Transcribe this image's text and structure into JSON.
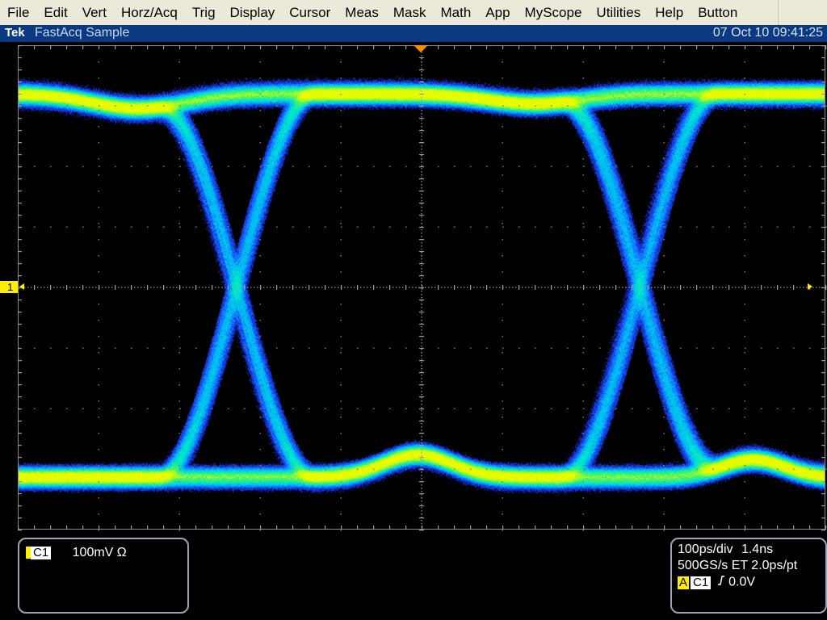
{
  "menu": [
    "File",
    "Edit",
    "Vert",
    "Horz/Acq",
    "Trig",
    "Display",
    "Cursor",
    "Meas",
    "Mask",
    "Math",
    "App",
    "MyScope",
    "Utilities",
    "Help",
    "Button"
  ],
  "titlebar": {
    "brand": "Tek",
    "mode": "FastAcq Sample",
    "datetime": "07 Oct 10 09:41:25"
  },
  "channel_marker": {
    "label": "1"
  },
  "channel_readout": {
    "channel": "C1",
    "scale": "100mV Ω"
  },
  "horizontal_readout": {
    "timebase": "100ps/div",
    "record": "1.4ns",
    "sample": "500GS/s ET 2.0ps/pt",
    "trigger_source_label": "A",
    "trigger_channel": "C1",
    "trigger_slope_icon": "rising-edge-icon",
    "trigger_level": "0.0V"
  },
  "colors": {
    "menu_bg": "#ece9d8",
    "titlebar_bg": "#0b3a82",
    "trace_yellow": "#ffee00",
    "graticule": "#8a8a8a"
  }
}
